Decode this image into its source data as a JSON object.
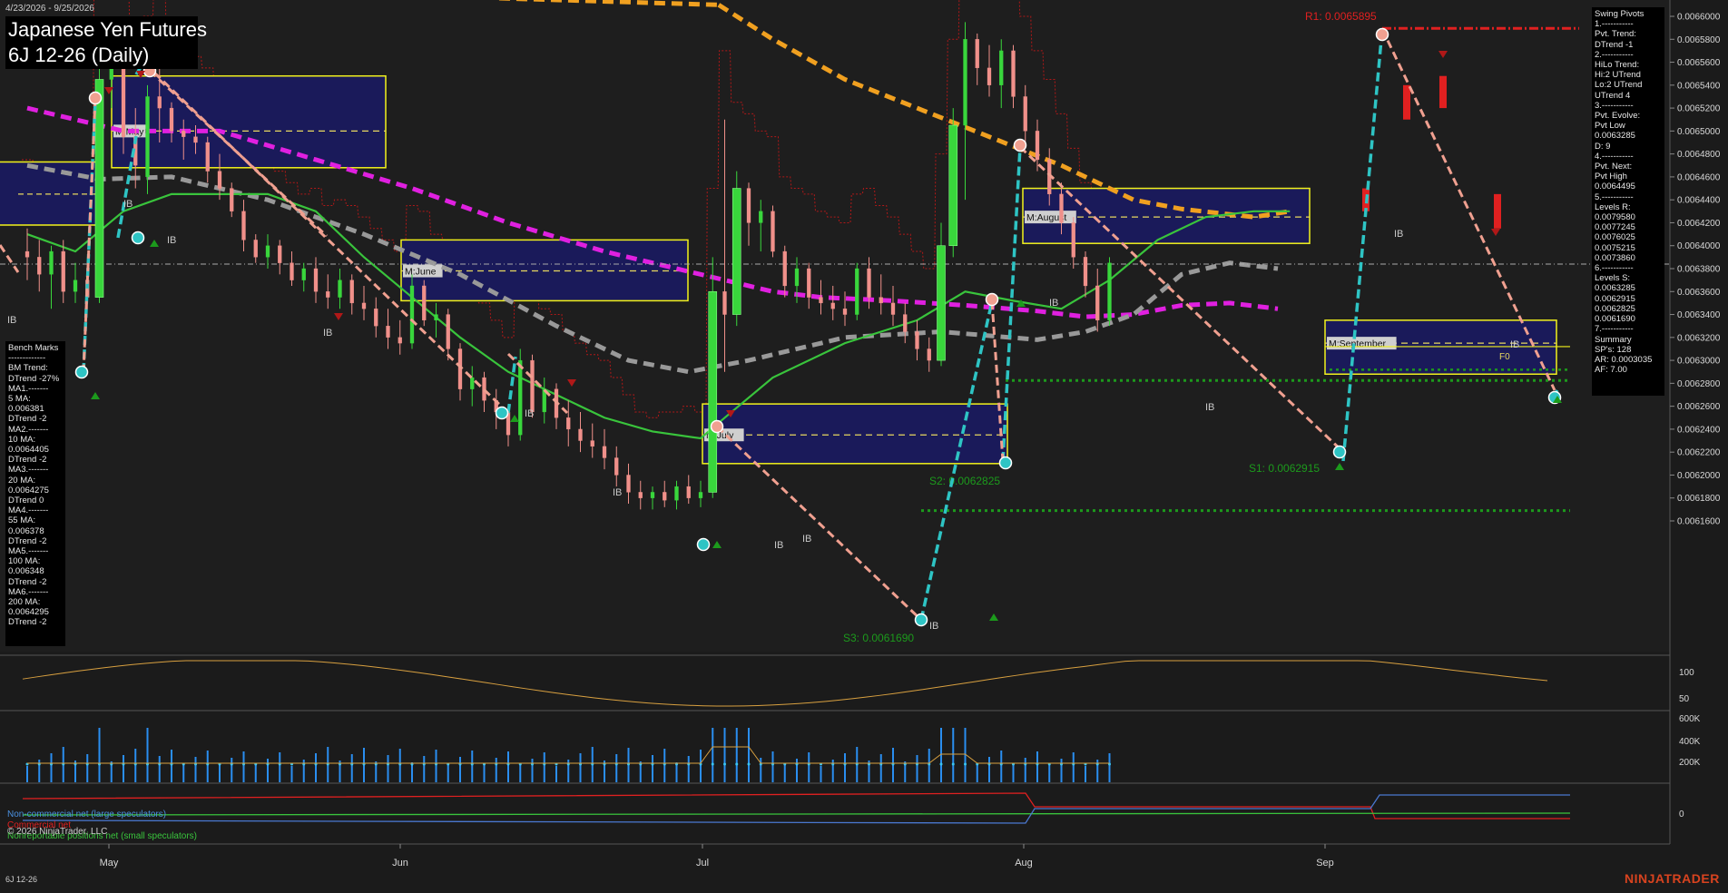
{
  "chart_data": {
    "type": "candlestick",
    "date_range_label": "4/23/2026 - 9/25/2026",
    "title": "Japanese Yen Futures",
    "subtitle": "6J 12-26 (Daily)",
    "instrument_footer": "6J 12-26",
    "brand": "NINJATRADER",
    "copyright": "© 2026 NinjaTrader, LLC",
    "x_months": [
      "May",
      "Jun",
      "Jul",
      "Aug",
      "Sep"
    ],
    "y_ticks": [
      "0.0066000",
      "0.0065800",
      "0.0065600",
      "0.0065400",
      "0.0065200",
      "0.0065000",
      "0.0064800",
      "0.0064600",
      "0.0064400",
      "0.0064200",
      "0.0064000",
      "0.0063800",
      "0.0063600",
      "0.0063400",
      "0.0063200",
      "0.0063000",
      "0.0062800",
      "0.0062600",
      "0.0062400",
      "0.0062200",
      "0.0062000",
      "0.0061800",
      "0.0061600"
    ],
    "ylim": [
      0.00614,
      0.00662
    ],
    "levels": {
      "r1": "R1: 0.0065895",
      "s1": "S1: 0.0062915",
      "s2": "S2: 0.0062825",
      "s3": "S3: 0.0061690"
    },
    "level_values": {
      "r1": 0.0065895,
      "s1": 0.0062915,
      "s2": 0.0062825,
      "s3": 0.006169
    },
    "month_box_labels": [
      "M:May",
      "M:June",
      "M:July",
      "M:August",
      "M:September"
    ],
    "ib_label": "IB",
    "f0_label": "F0",
    "candles": [
      {
        "d": 0,
        "o": 0.006395,
        "h": 0.006415,
        "l": 0.00637,
        "c": 0.00639
      },
      {
        "d": 1,
        "o": 0.00639,
        "h": 0.006405,
        "l": 0.00636,
        "c": 0.006375
      },
      {
        "d": 2,
        "o": 0.006375,
        "h": 0.0064,
        "l": 0.006345,
        "c": 0.006395
      },
      {
        "d": 3,
        "o": 0.006395,
        "h": 0.006405,
        "l": 0.00635,
        "c": 0.00636
      },
      {
        "d": 4,
        "o": 0.00636,
        "h": 0.006385,
        "l": 0.00635,
        "c": 0.00637
      },
      {
        "d": 5,
        "o": 0.00637,
        "h": 0.00638,
        "l": 0.006345,
        "c": 0.006355
      },
      {
        "d": 6,
        "o": 0.006355,
        "h": 0.00656,
        "l": 0.00635,
        "c": 0.006545
      },
      {
        "d": 7,
        "o": 0.006545,
        "h": 0.006575,
        "l": 0.00652,
        "c": 0.006555
      },
      {
        "d": 8,
        "o": 0.006555,
        "h": 0.00656,
        "l": 0.00648,
        "c": 0.006495
      },
      {
        "d": 9,
        "o": 0.006495,
        "h": 0.00652,
        "l": 0.00645,
        "c": 0.00647
      },
      {
        "d": 10,
        "o": 0.00646,
        "h": 0.00654,
        "l": 0.006445,
        "c": 0.00653
      },
      {
        "d": 11,
        "o": 0.00653,
        "h": 0.00658,
        "l": 0.00649,
        "c": 0.00652
      },
      {
        "d": 12,
        "o": 0.00652,
        "h": 0.006525,
        "l": 0.00649,
        "c": 0.0065
      },
      {
        "d": 13,
        "o": 0.0065,
        "h": 0.00651,
        "l": 0.006475,
        "c": 0.006495
      },
      {
        "d": 14,
        "o": 0.006495,
        "h": 0.006505,
        "l": 0.00648,
        "c": 0.00649
      },
      {
        "d": 15,
        "o": 0.00649,
        "h": 0.006495,
        "l": 0.006455,
        "c": 0.006465
      },
      {
        "d": 16,
        "o": 0.006465,
        "h": 0.00648,
        "l": 0.00644,
        "c": 0.00645
      },
      {
        "d": 17,
        "o": 0.00645,
        "h": 0.006455,
        "l": 0.006425,
        "c": 0.00643
      },
      {
        "d": 18,
        "o": 0.00643,
        "h": 0.00644,
        "l": 0.006395,
        "c": 0.006405
      },
      {
        "d": 19,
        "o": 0.006405,
        "h": 0.00641,
        "l": 0.006385,
        "c": 0.00639
      },
      {
        "d": 20,
        "o": 0.00639,
        "h": 0.00641,
        "l": 0.00638,
        "c": 0.0064
      },
      {
        "d": 21,
        "o": 0.0064,
        "h": 0.006405,
        "l": 0.006375,
        "c": 0.006385
      },
      {
        "d": 22,
        "o": 0.006385,
        "h": 0.006395,
        "l": 0.006365,
        "c": 0.00637
      },
      {
        "d": 23,
        "o": 0.00637,
        "h": 0.006385,
        "l": 0.00636,
        "c": 0.00638
      },
      {
        "d": 24,
        "o": 0.00638,
        "h": 0.00639,
        "l": 0.00635,
        "c": 0.00636
      },
      {
        "d": 25,
        "o": 0.00636,
        "h": 0.006375,
        "l": 0.006345,
        "c": 0.006355
      },
      {
        "d": 26,
        "o": 0.006355,
        "h": 0.00638,
        "l": 0.006345,
        "c": 0.00637
      },
      {
        "d": 27,
        "o": 0.00637,
        "h": 0.006375,
        "l": 0.00634,
        "c": 0.00635
      },
      {
        "d": 28,
        "o": 0.00635,
        "h": 0.006365,
        "l": 0.006335,
        "c": 0.006345
      },
      {
        "d": 29,
        "o": 0.006345,
        "h": 0.006355,
        "l": 0.00632,
        "c": 0.00633
      },
      {
        "d": 30,
        "o": 0.00633,
        "h": 0.006345,
        "l": 0.00631,
        "c": 0.00632
      },
      {
        "d": 31,
        "o": 0.00632,
        "h": 0.006335,
        "l": 0.006305,
        "c": 0.006315
      },
      {
        "d": 32,
        "o": 0.006315,
        "h": 0.006375,
        "l": 0.00631,
        "c": 0.006365
      },
      {
        "d": 33,
        "o": 0.006365,
        "h": 0.00637,
        "l": 0.00633,
        "c": 0.006335
      },
      {
        "d": 34,
        "o": 0.006335,
        "h": 0.00635,
        "l": 0.00632,
        "c": 0.00634
      },
      {
        "d": 35,
        "o": 0.00634,
        "h": 0.006345,
        "l": 0.0063,
        "c": 0.00631
      },
      {
        "d": 36,
        "o": 0.00631,
        "h": 0.006315,
        "l": 0.006265,
        "c": 0.006275
      },
      {
        "d": 37,
        "o": 0.006275,
        "h": 0.006295,
        "l": 0.00626,
        "c": 0.006285
      },
      {
        "d": 38,
        "o": 0.006285,
        "h": 0.00629,
        "l": 0.006255,
        "c": 0.006265
      },
      {
        "d": 39,
        "o": 0.006265,
        "h": 0.006275,
        "l": 0.00624,
        "c": 0.006255
      },
      {
        "d": 40,
        "o": 0.006255,
        "h": 0.00626,
        "l": 0.006225,
        "c": 0.006235
      },
      {
        "d": 41,
        "o": 0.006235,
        "h": 0.00631,
        "l": 0.00623,
        "c": 0.0063
      },
      {
        "d": 42,
        "o": 0.0063,
        "h": 0.006305,
        "l": 0.00625,
        "c": 0.006255
      },
      {
        "d": 43,
        "o": 0.006255,
        "h": 0.006285,
        "l": 0.006245,
        "c": 0.006275
      },
      {
        "d": 44,
        "o": 0.006275,
        "h": 0.00628,
        "l": 0.00624,
        "c": 0.00625
      },
      {
        "d": 45,
        "o": 0.00625,
        "h": 0.006265,
        "l": 0.006225,
        "c": 0.00624
      },
      {
        "d": 46,
        "o": 0.00624,
        "h": 0.006255,
        "l": 0.00622,
        "c": 0.00623
      },
      {
        "d": 47,
        "o": 0.00623,
        "h": 0.006245,
        "l": 0.006215,
        "c": 0.006225
      },
      {
        "d": 48,
        "o": 0.006225,
        "h": 0.00624,
        "l": 0.006205,
        "c": 0.006215
      },
      {
        "d": 49,
        "o": 0.006215,
        "h": 0.006225,
        "l": 0.00619,
        "c": 0.0062
      },
      {
        "d": 50,
        "o": 0.0062,
        "h": 0.00621,
        "l": 0.006175,
        "c": 0.006185
      },
      {
        "d": 51,
        "o": 0.006185,
        "h": 0.006195,
        "l": 0.00617,
        "c": 0.00618
      },
      {
        "d": 52,
        "o": 0.00618,
        "h": 0.00619,
        "l": 0.00617,
        "c": 0.006185
      },
      {
        "d": 53,
        "o": 0.006185,
        "h": 0.006195,
        "l": 0.006172,
        "c": 0.006178
      },
      {
        "d": 54,
        "o": 0.006178,
        "h": 0.006195,
        "l": 0.00617,
        "c": 0.00619
      },
      {
        "d": 55,
        "o": 0.00619,
        "h": 0.0062,
        "l": 0.006175,
        "c": 0.00618
      },
      {
        "d": 56,
        "o": 0.00618,
        "h": 0.006195,
        "l": 0.006172,
        "c": 0.006185
      },
      {
        "d": 57,
        "o": 0.006185,
        "h": 0.00639,
        "l": 0.00618,
        "c": 0.00636
      },
      {
        "d": 58,
        "o": 0.00636,
        "h": 0.00651,
        "l": 0.00629,
        "c": 0.00634
      },
      {
        "d": 59,
        "o": 0.00634,
        "h": 0.006465,
        "l": 0.00633,
        "c": 0.00645
      },
      {
        "d": 60,
        "o": 0.00645,
        "h": 0.006455,
        "l": 0.0064,
        "c": 0.00642
      },
      {
        "d": 61,
        "o": 0.00642,
        "h": 0.00644,
        "l": 0.006395,
        "c": 0.00643
      },
      {
        "d": 62,
        "o": 0.00643,
        "h": 0.006435,
        "l": 0.00639,
        "c": 0.006395
      },
      {
        "d": 63,
        "o": 0.006395,
        "h": 0.0064,
        "l": 0.006355,
        "c": 0.006365
      },
      {
        "d": 64,
        "o": 0.006365,
        "h": 0.00639,
        "l": 0.00635,
        "c": 0.00638
      },
      {
        "d": 65,
        "o": 0.00638,
        "h": 0.006385,
        "l": 0.006345,
        "c": 0.006355
      },
      {
        "d": 66,
        "o": 0.006355,
        "h": 0.00637,
        "l": 0.00634,
        "c": 0.00635
      },
      {
        "d": 67,
        "o": 0.00635,
        "h": 0.006365,
        "l": 0.006335,
        "c": 0.006345
      },
      {
        "d": 68,
        "o": 0.006345,
        "h": 0.00636,
        "l": 0.00633,
        "c": 0.00634
      },
      {
        "d": 69,
        "o": 0.00634,
        "h": 0.006385,
        "l": 0.006335,
        "c": 0.00638
      },
      {
        "d": 70,
        "o": 0.00638,
        "h": 0.00639,
        "l": 0.006345,
        "c": 0.006355
      },
      {
        "d": 71,
        "o": 0.006355,
        "h": 0.006375,
        "l": 0.00634,
        "c": 0.00635
      },
      {
        "d": 72,
        "o": 0.00635,
        "h": 0.006365,
        "l": 0.00633,
        "c": 0.00634
      },
      {
        "d": 73,
        "o": 0.00634,
        "h": 0.00635,
        "l": 0.006315,
        "c": 0.006325
      },
      {
        "d": 74,
        "o": 0.006325,
        "h": 0.006335,
        "l": 0.0063,
        "c": 0.00631
      },
      {
        "d": 75,
        "o": 0.00631,
        "h": 0.00632,
        "l": 0.00629,
        "c": 0.0063
      },
      {
        "d": 76,
        "o": 0.0063,
        "h": 0.00642,
        "l": 0.006295,
        "c": 0.0064
      },
      {
        "d": 77,
        "o": 0.0064,
        "h": 0.00652,
        "l": 0.00639,
        "c": 0.006505
      },
      {
        "d": 78,
        "o": 0.006505,
        "h": 0.006595,
        "l": 0.00644,
        "c": 0.00658
      },
      {
        "d": 79,
        "o": 0.00658,
        "h": 0.006585,
        "l": 0.00654,
        "c": 0.006555
      },
      {
        "d": 80,
        "o": 0.006555,
        "h": 0.006575,
        "l": 0.00653,
        "c": 0.00654
      },
      {
        "d": 81,
        "o": 0.00654,
        "h": 0.00658,
        "l": 0.00652,
        "c": 0.00657
      },
      {
        "d": 82,
        "o": 0.00657,
        "h": 0.006575,
        "l": 0.00652,
        "c": 0.00653
      },
      {
        "d": 83,
        "o": 0.00653,
        "h": 0.00654,
        "l": 0.00649,
        "c": 0.0065
      },
      {
        "d": 84,
        "o": 0.0065,
        "h": 0.00651,
        "l": 0.006465,
        "c": 0.006475
      },
      {
        "d": 85,
        "o": 0.006475,
        "h": 0.006485,
        "l": 0.006435,
        "c": 0.006445
      },
      {
        "d": 86,
        "o": 0.006445,
        "h": 0.006455,
        "l": 0.00641,
        "c": 0.00642
      },
      {
        "d": 87,
        "o": 0.00642,
        "h": 0.006425,
        "l": 0.00638,
        "c": 0.00639
      },
      {
        "d": 88,
        "o": 0.00639,
        "h": 0.006395,
        "l": 0.006355,
        "c": 0.006365
      },
      {
        "d": 89,
        "o": 0.006365,
        "h": 0.00638,
        "l": 0.006325,
        "c": 0.006335
      },
      {
        "d": 90,
        "o": 0.006335,
        "h": 0.00639,
        "l": 0.00633,
        "c": 0.006385
      }
    ],
    "moving_averages": [
      {
        "name": "200 MA",
        "color": "#f0a020",
        "dash": true,
        "points": [
          [
            57.5,
            0.00661
          ],
          [
            62,
            0.00658
          ],
          [
            68,
            0.006545
          ],
          [
            74,
            0.00652
          ],
          [
            80,
            0.006495
          ],
          [
            86,
            0.00647
          ],
          [
            92,
            0.00644
          ],
          [
            96,
            0.006432
          ],
          [
            102,
            0.006425
          ],
          [
            105,
            0.00643
          ]
        ]
      },
      {
        "name": "100 MA",
        "color": "#e020e0",
        "dash": true,
        "points": [
          [
            0,
            0.00652
          ],
          [
            8,
            0.0065
          ],
          [
            16,
            0.0065
          ],
          [
            24,
            0.006475
          ],
          [
            32,
            0.00645
          ],
          [
            40,
            0.00642
          ],
          [
            48,
            0.006395
          ],
          [
            56,
            0.006375
          ],
          [
            62,
            0.00636
          ],
          [
            66,
            0.006355
          ],
          [
            72,
            0.006352
          ],
          [
            78,
            0.006348
          ],
          [
            84,
            0.006343
          ],
          [
            88,
            0.006338
          ],
          [
            92,
            0.00634
          ],
          [
            96,
            0.006348
          ],
          [
            100,
            0.00635
          ],
          [
            104,
            0.006345
          ]
        ]
      },
      {
        "name": "55 MA",
        "color": "#999999",
        "dash": true,
        "points": [
          [
            0,
            0.00647
          ],
          [
            6,
            0.006458
          ],
          [
            12,
            0.00646
          ],
          [
            20,
            0.00644
          ],
          [
            28,
            0.00641
          ],
          [
            36,
            0.006375
          ],
          [
            44,
            0.00633
          ],
          [
            50,
            0.0063
          ],
          [
            55,
            0.00629
          ],
          [
            60,
            0.0063
          ],
          [
            68,
            0.00632
          ],
          [
            76,
            0.006325
          ],
          [
            84,
            0.006318
          ],
          [
            88,
            0.006325
          ],
          [
            92,
            0.00634
          ],
          [
            96,
            0.006375
          ],
          [
            100,
            0.006385
          ],
          [
            104,
            0.00638
          ]
        ]
      },
      {
        "name": "20 MA",
        "color": "#39c43c",
        "dash": false,
        "points": [
          [
            0,
            0.00641
          ],
          [
            4,
            0.006395
          ],
          [
            8,
            0.00643
          ],
          [
            12,
            0.006445
          ],
          [
            16,
            0.006445
          ],
          [
            20,
            0.006445
          ],
          [
            24,
            0.00643
          ],
          [
            28,
            0.00639
          ],
          [
            32,
            0.006355
          ],
          [
            36,
            0.00632
          ],
          [
            40,
            0.00629
          ],
          [
            44,
            0.00627
          ],
          [
            48,
            0.00625
          ],
          [
            52,
            0.006238
          ],
          [
            56,
            0.006232
          ],
          [
            58,
            0.00625
          ],
          [
            62,
            0.006285
          ],
          [
            68,
            0.006315
          ],
          [
            74,
            0.006335
          ],
          [
            78,
            0.00636
          ],
          [
            82,
            0.006352
          ],
          [
            86,
            0.006345
          ],
          [
            90,
            0.00637
          ],
          [
            94,
            0.006405
          ],
          [
            98,
            0.006425
          ],
          [
            102,
            0.00643
          ],
          [
            105,
            0.00643
          ]
        ]
      }
    ],
    "oscillator_ticks": [
      "100",
      "50"
    ],
    "volume_ticks": [
      "600K",
      "400K",
      "200K"
    ],
    "cot_ticks": [
      "0"
    ],
    "cot_legend": [
      {
        "label": "Non-commercial net (large speculators)",
        "color": "#4a90e0"
      },
      {
        "label": "Commercial net",
        "color": "#e02020"
      },
      {
        "label": "Nonreportable positions net (small speculators)",
        "color": "#39c43c"
      }
    ],
    "bench_marks": [
      "Bench Marks",
      "-------------",
      "BM Trend:",
      "DTrend -27%",
      "MA1.-------",
      "5 MA:",
      "0.006381",
      "DTrend -2",
      "MA2.-------",
      "10 MA:",
      "0.0064405",
      "DTrend -2",
      "MA3.-------",
      "20 MA:",
      "0.0064275",
      "DTrend 0",
      "MA4.-------",
      "55 MA:",
      "0.006378",
      "DTrend -2",
      "MA5.-------",
      "100 MA:",
      "0.006348",
      "DTrend -2",
      "MA6.-------",
      "200 MA:",
      "0.0064295",
      "DTrend -2"
    ],
    "swing_pivots": [
      "Swing Pivots",
      "1.-----------",
      "Pvt. Trend:",
      "DTrend -1",
      "2.-----------",
      "HiLo Trend:",
      "Hi:2 UTrend",
      "Lo:2 UTrend",
      "UTrend 4",
      "3.-----------",
      "Pvt. Evolve:",
      "Pvt Low",
      "0.0063285",
      "D: 9",
      "4.-----------",
      "Pvt. Next:",
      "Pvt High",
      "0.0064495",
      "5.-----------",
      "Levels R:",
      "0.0079580",
      "0.0077245",
      "0.0076025",
      "0.0075215",
      "0.0073860",
      "6.-----------",
      "Levels S:",
      "0.0063285",
      "0.0062915",
      "0.0062825",
      "0.0061690",
      "7.-----------",
      "Summary",
      "SP's: 128",
      "AR: 0.0003035",
      "AF: 7.00"
    ]
  }
}
